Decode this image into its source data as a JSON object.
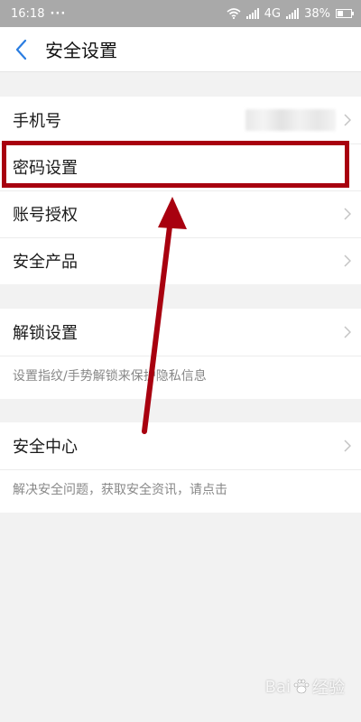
{
  "status_bar": {
    "time": "16:18",
    "dots": "···",
    "network": "4G",
    "battery": "38%"
  },
  "header": {
    "title": "安全设置"
  },
  "section1": {
    "items": [
      {
        "label": "手机号"
      },
      {
        "label": "密码设置"
      },
      {
        "label": "账号授权"
      },
      {
        "label": "安全产品"
      }
    ]
  },
  "section2": {
    "label": "解锁设置",
    "hint": "设置指纹/手势解锁来保护隐私信息"
  },
  "section3": {
    "label": "安全中心",
    "hint": "解决安全问题，获取安全资讯，请点击"
  },
  "annotation": {
    "color": "#a8000f"
  },
  "watermark": {
    "brand": "Bai",
    "suffix": "经验"
  },
  "colors": {
    "status_bar": "#a9a9a9",
    "accent_back": "#2a7de1",
    "background": "#f2f2f2"
  }
}
